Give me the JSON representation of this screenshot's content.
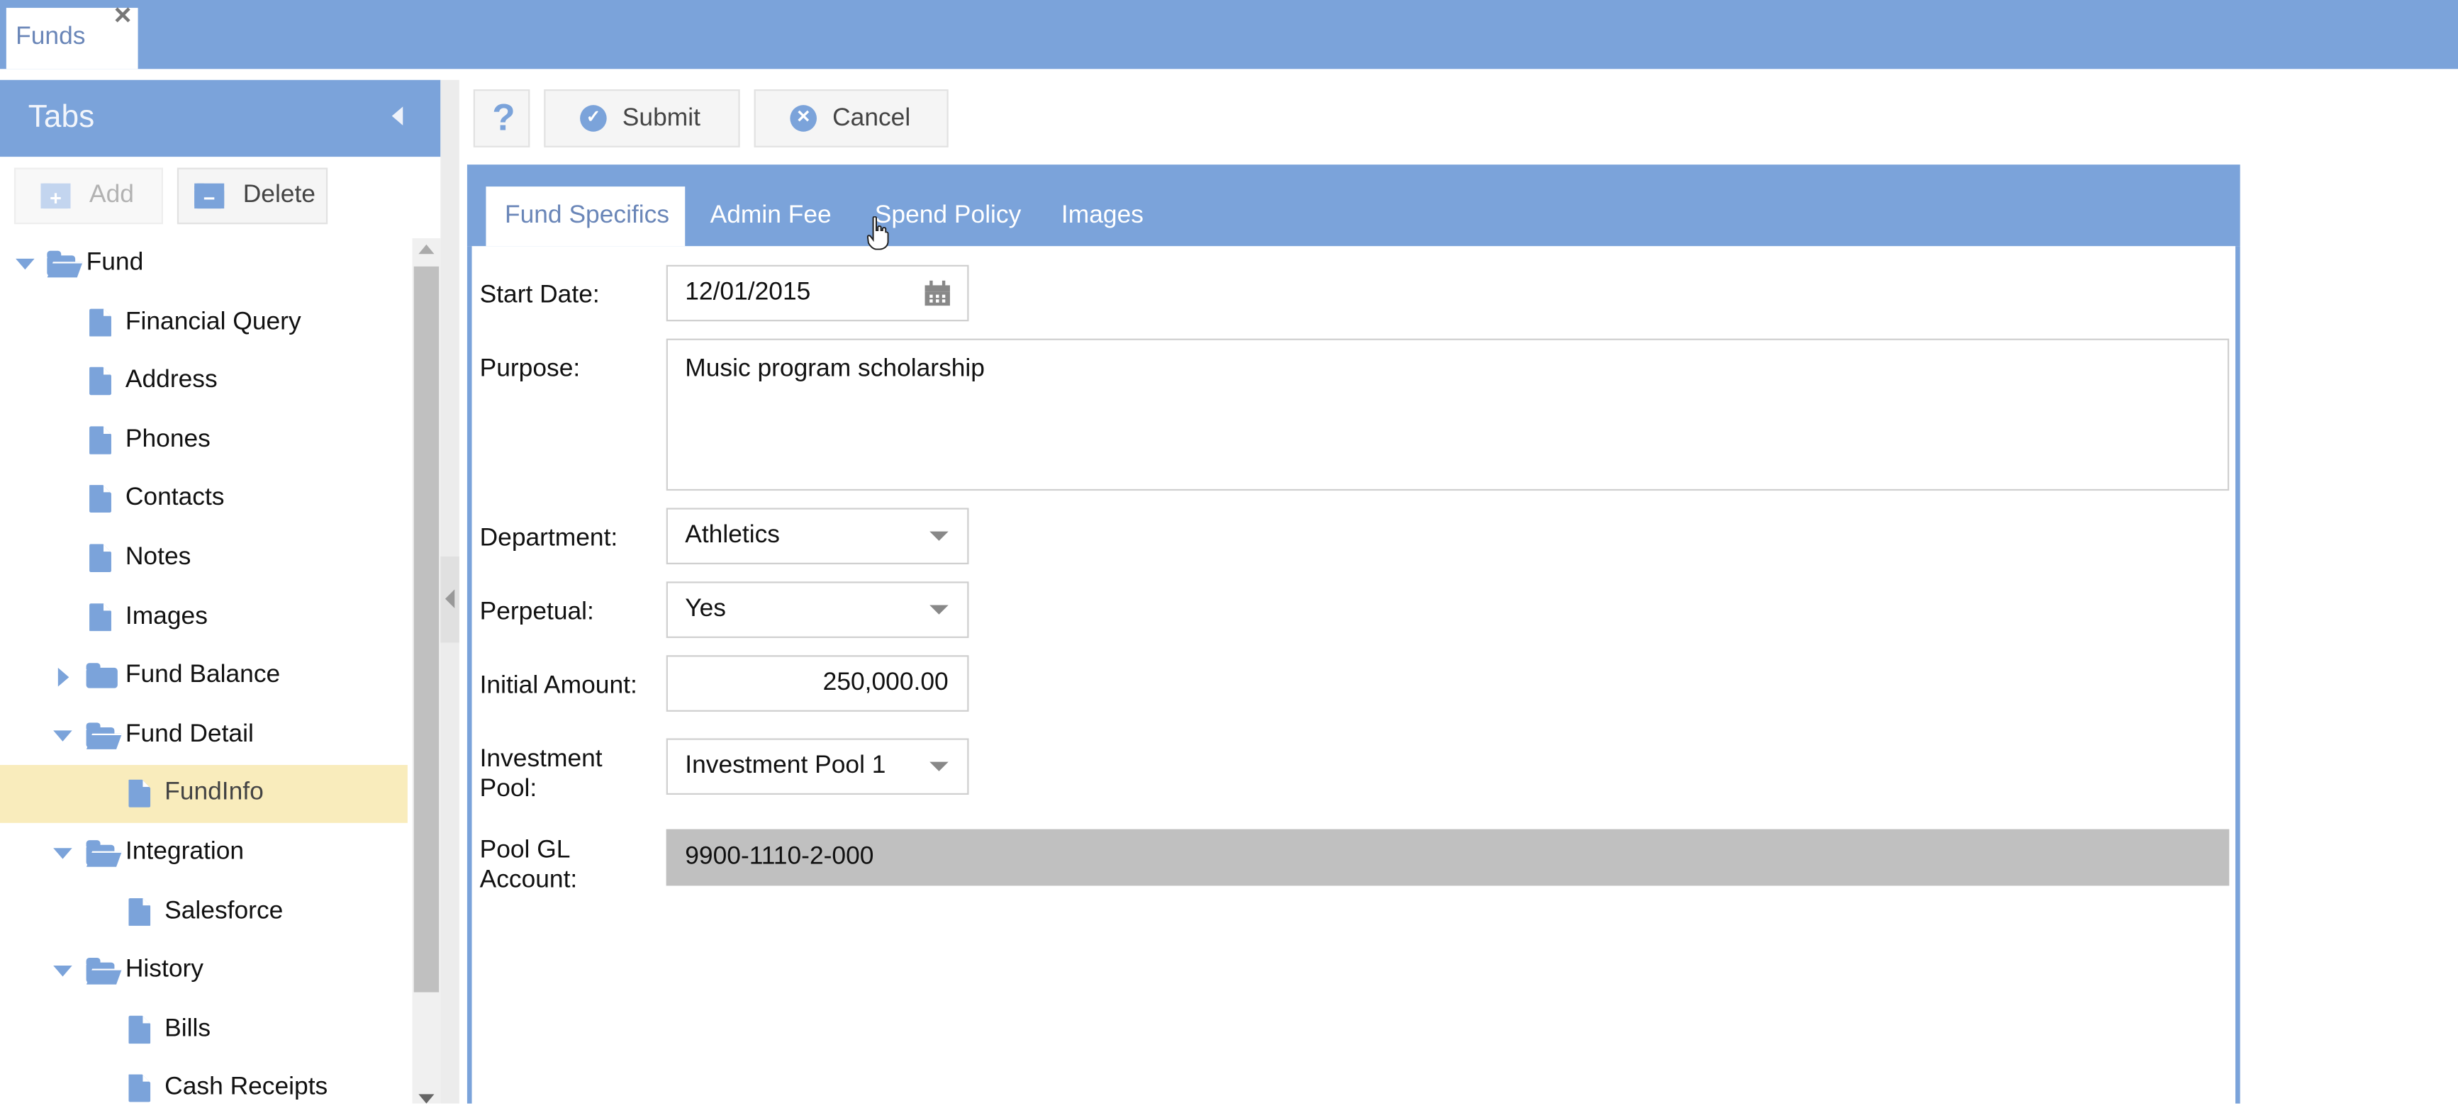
{
  "window": {
    "tab_label": "Funds",
    "close_icon": "close-icon"
  },
  "sidebar": {
    "title": "Tabs",
    "collapse_icon": "chevron-left-icon",
    "add_label": "Add",
    "delete_label": "Delete",
    "tree": [
      {
        "label": "Fund",
        "type": "folder",
        "expanded": true,
        "level": 0
      },
      {
        "label": "Financial Query",
        "type": "file",
        "level": 1
      },
      {
        "label": "Address",
        "type": "file",
        "level": 1
      },
      {
        "label": "Phones",
        "type": "file",
        "level": 1
      },
      {
        "label": "Contacts",
        "type": "file",
        "level": 1
      },
      {
        "label": "Notes",
        "type": "file",
        "level": 1
      },
      {
        "label": "Images",
        "type": "file",
        "level": 1
      },
      {
        "label": "Fund Balance",
        "type": "folder",
        "expanded": false,
        "level": 1
      },
      {
        "label": "Fund Detail",
        "type": "folder",
        "expanded": true,
        "level": 1
      },
      {
        "label": "FundInfo",
        "type": "file",
        "level": 2,
        "selected": true
      },
      {
        "label": "Integration",
        "type": "folder",
        "expanded": true,
        "level": 1
      },
      {
        "label": "Salesforce",
        "type": "file",
        "level": 2
      },
      {
        "label": "History",
        "type": "folder",
        "expanded": true,
        "level": 1
      },
      {
        "label": "Bills",
        "type": "file",
        "level": 2
      },
      {
        "label": "Cash Receipts",
        "type": "file",
        "level": 2
      }
    ]
  },
  "toolbar": {
    "help_glyph": "?",
    "submit_label": "Submit",
    "cancel_label": "Cancel"
  },
  "form": {
    "tabs": [
      {
        "label": "Fund Specifics",
        "active": true
      },
      {
        "label": "Admin Fee",
        "active": false
      },
      {
        "label": "Spend Policy",
        "active": false
      },
      {
        "label": "Images",
        "active": false
      }
    ],
    "start_date": {
      "label": "Start Date:",
      "value": "12/01/2015"
    },
    "purpose": {
      "label": "Purpose:",
      "value": "Music program scholarship"
    },
    "department": {
      "label": "Department:",
      "value": "Athletics"
    },
    "perpetual": {
      "label": "Perpetual:",
      "value": "Yes"
    },
    "initial_amount": {
      "label": "Initial Amount:",
      "value": "250,000.00"
    },
    "investment_pool": {
      "label_line1": "Investment",
      "label_line2": "Pool:",
      "value": "Investment Pool 1"
    },
    "pool_gl_account": {
      "label_line1": "Pool GL",
      "label_line2": "Account:",
      "value": "9900-1110-2-000"
    }
  },
  "colors": {
    "accent": "#7ba3da",
    "selected_row": "#f9ecbc",
    "readonly_field": "#c0c0c0"
  }
}
